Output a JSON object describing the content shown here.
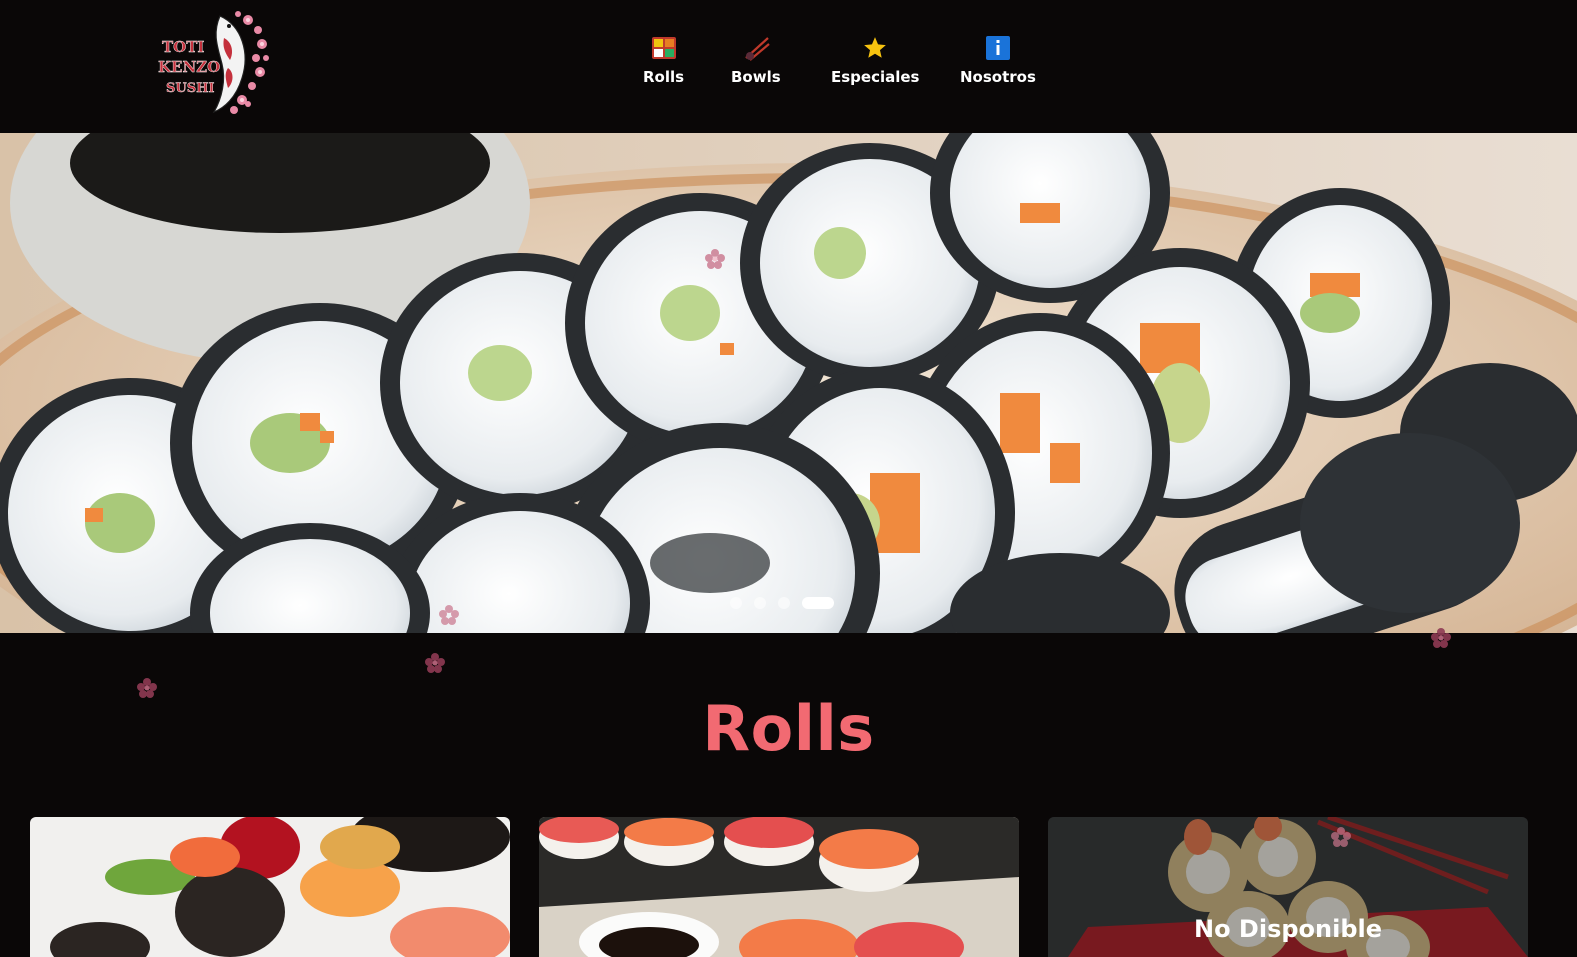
{
  "brand": {
    "logo_lines": [
      "TOTI",
      "KENZO",
      "SUSHI"
    ],
    "accent": "#c4303c",
    "blossom": "#e98aa6"
  },
  "nav": {
    "items": [
      {
        "label": "Rolls",
        "icon": "bento-box-icon"
      },
      {
        "label": "Bowls",
        "icon": "chopsticks-icon"
      },
      {
        "label": "Especiales",
        "icon": "star-icon"
      },
      {
        "label": "Nosotros",
        "icon": "info-icon"
      }
    ]
  },
  "carousel": {
    "slide_count": 4,
    "active_index": 3
  },
  "section": {
    "title": "Rolls",
    "title_color": "#f26a72"
  },
  "cards": [
    {
      "status": ""
    },
    {
      "status": ""
    },
    {
      "status": "No Disponible"
    }
  ]
}
